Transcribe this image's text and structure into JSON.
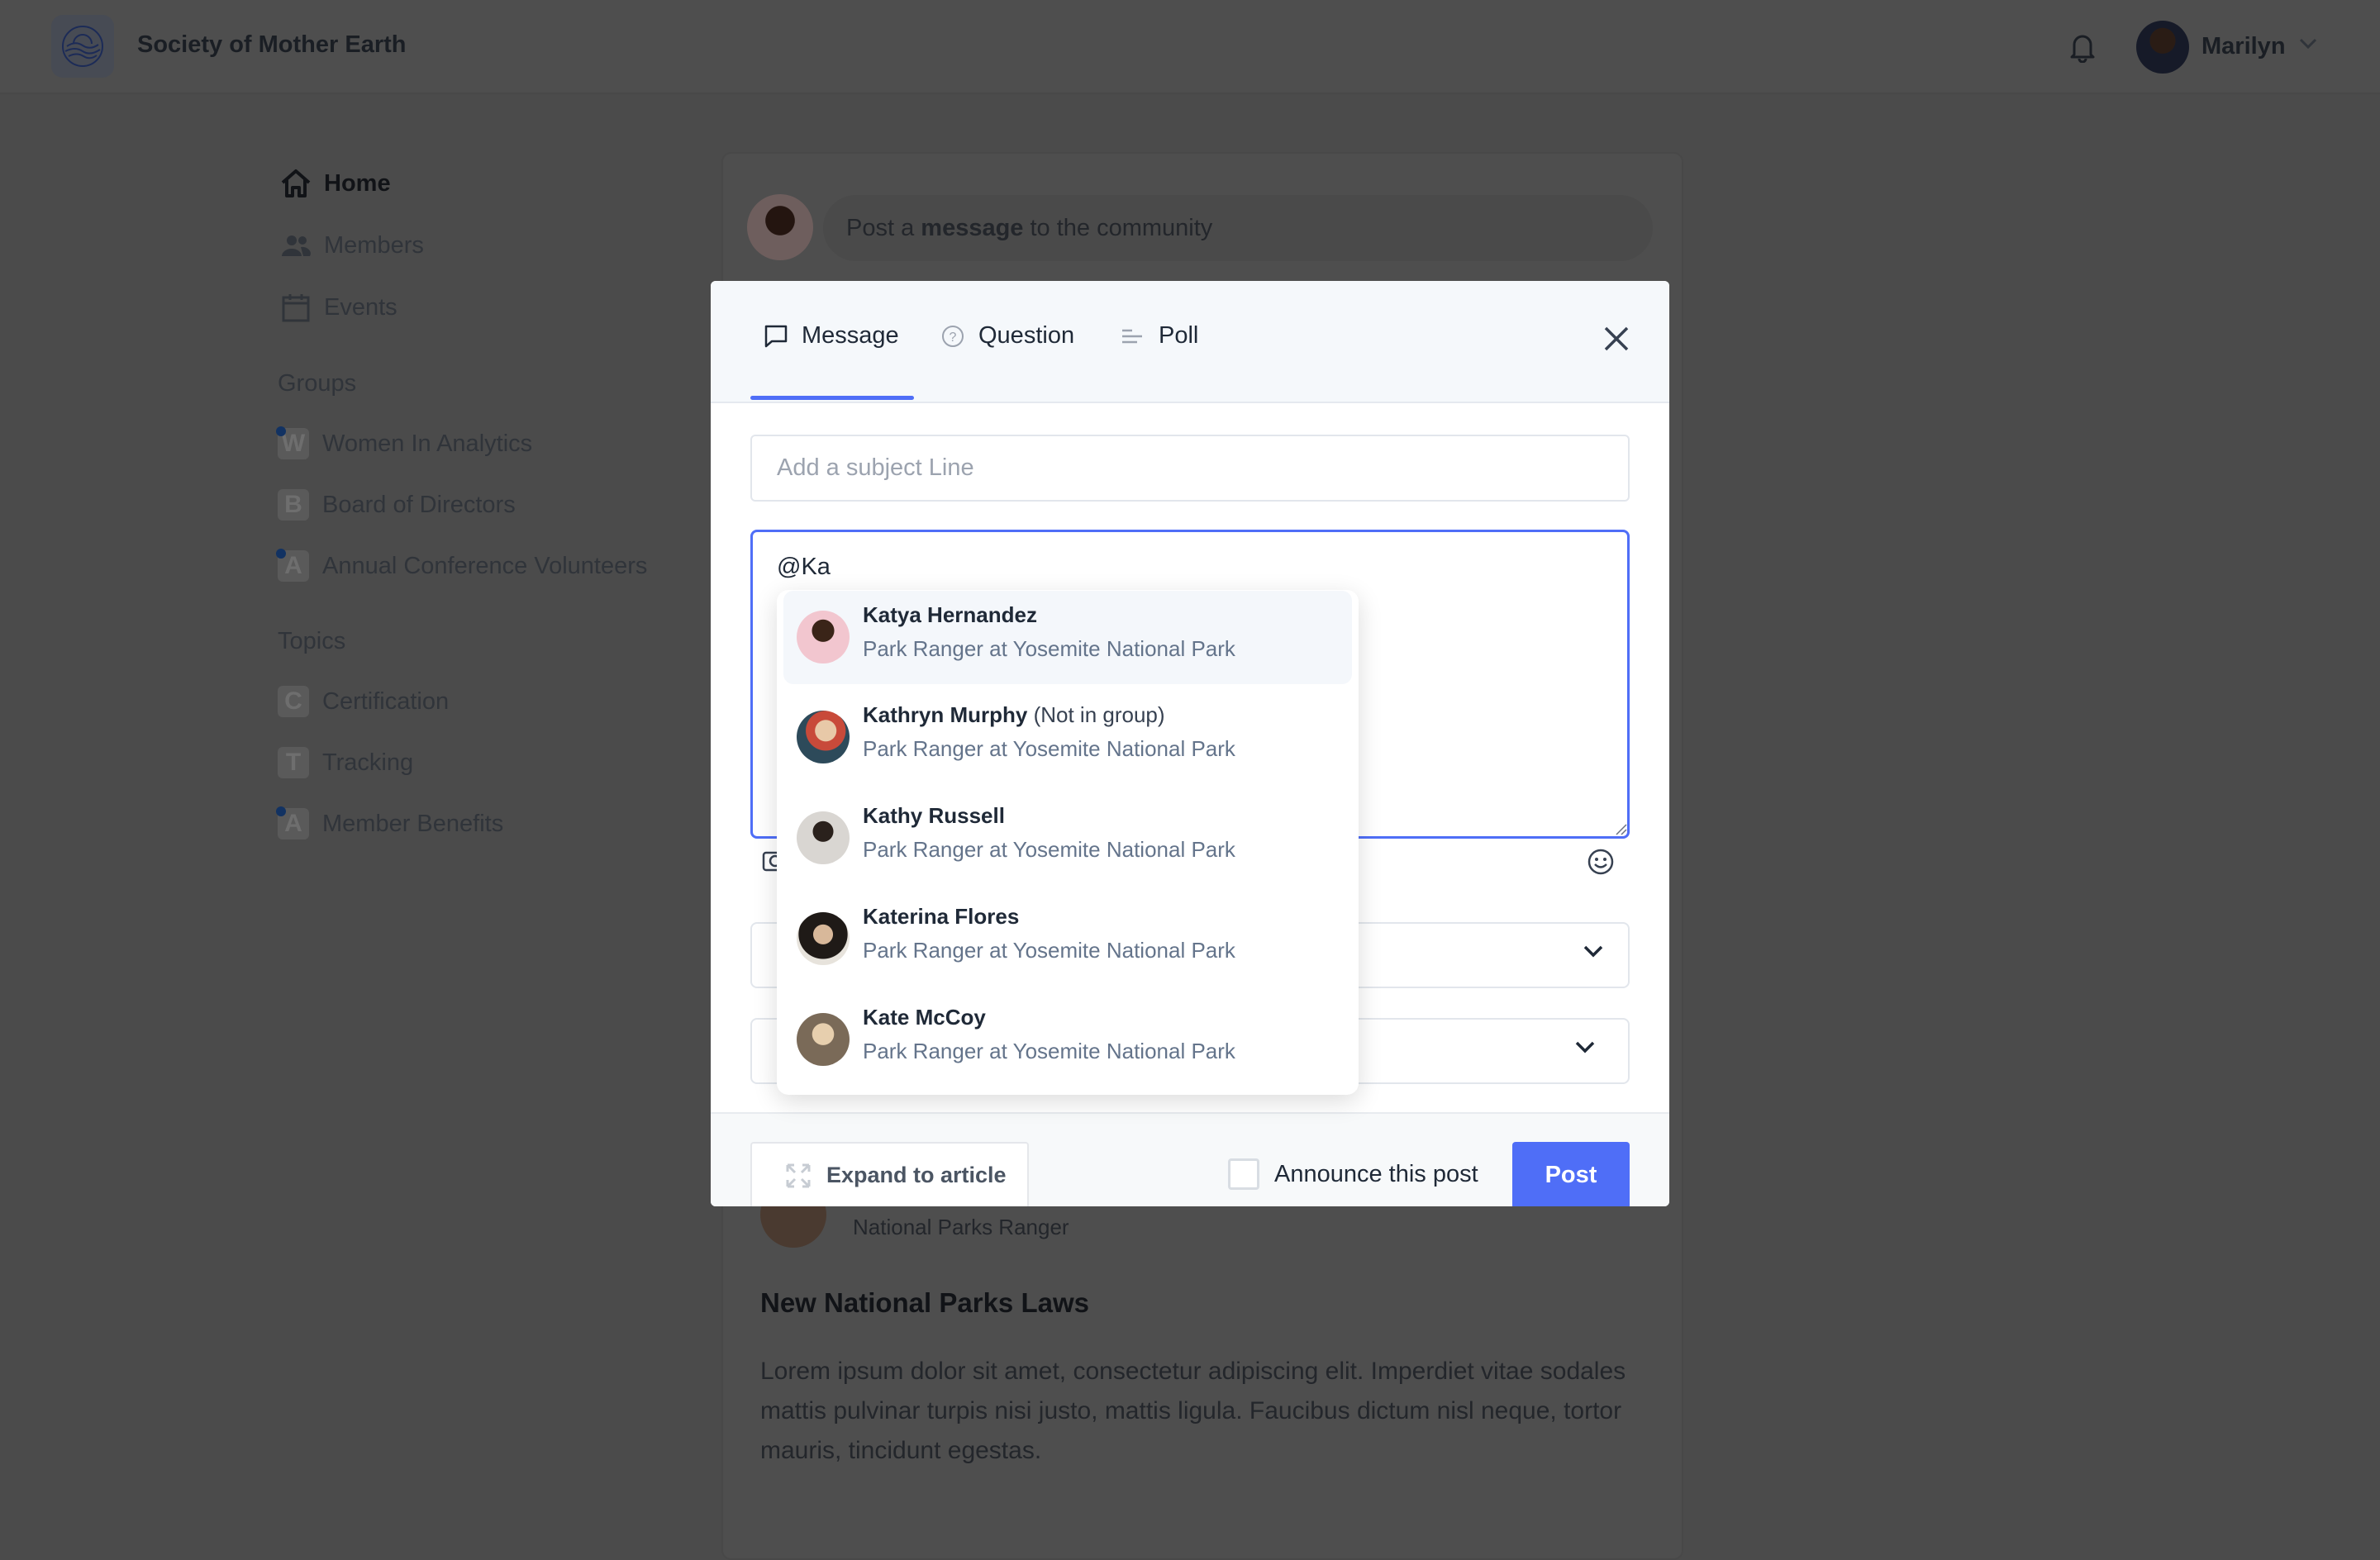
{
  "header": {
    "app_title": "Society of Mother Earth",
    "user_name": "Marilyn"
  },
  "sidebar": {
    "nav": [
      {
        "label": "Home",
        "icon": "home-icon",
        "active": true
      },
      {
        "label": "Members",
        "icon": "members-icon"
      },
      {
        "label": "Events",
        "icon": "calendar-icon"
      }
    ],
    "groups_heading": "Groups",
    "groups": [
      {
        "badge": "W",
        "label": "Women In Analytics",
        "unread": true
      },
      {
        "badge": "B",
        "label": "Board of Directors",
        "unread": false
      },
      {
        "badge": "A",
        "label": "Annual Conference Volunteers",
        "unread": true
      }
    ],
    "topics_heading": "Topics",
    "topics": [
      {
        "badge": "C",
        "label": "Certification",
        "unread": false
      },
      {
        "badge": "T",
        "label": "Tracking",
        "unread": false
      },
      {
        "badge": "A",
        "label": "Member Benefits",
        "unread": true
      }
    ]
  },
  "feed": {
    "composer_prefix": "Post a ",
    "composer_bold": "message",
    "composer_suffix": " to the community",
    "post": {
      "author_title": "National Parks Ranger",
      "title": "New National Parks Laws",
      "body": "Lorem ipsum dolor sit amet, consectetur adipiscing elit. Imperdiet vitae sodales mattis pulvinar turpis nisi justo, mattis ligula. Faucibus dictum nisl neque, tortor mauris, tincidunt egestas."
    }
  },
  "modal": {
    "tabs": [
      {
        "label": "Message",
        "icon": "message-icon",
        "active": true
      },
      {
        "label": "Question",
        "icon": "question-icon"
      },
      {
        "label": "Poll",
        "icon": "poll-icon"
      }
    ],
    "subject_placeholder": "Add a subject Line",
    "body_value": "@Ka",
    "expand_label": "Expand to article",
    "announce_label": "Announce this post",
    "announce_checked": false,
    "post_label": "Post",
    "accent": "#4f6ef7"
  },
  "mentions": [
    {
      "name": "Katya Hernandez",
      "note": "",
      "subtitle": "Park Ranger at Yosemite National Park",
      "highlighted": true
    },
    {
      "name": "Kathryn Murphy",
      "note": "(Not in group)",
      "subtitle": "Park Ranger at Yosemite National Park"
    },
    {
      "name": "Kathy Russell",
      "note": "",
      "subtitle": "Park Ranger at Yosemite National Park"
    },
    {
      "name": "Katerina Flores",
      "note": "",
      "subtitle": "Park Ranger at Yosemite National Park"
    },
    {
      "name": "Kate McCoy",
      "note": "",
      "subtitle": "Park Ranger at Yosemite National Park"
    }
  ]
}
